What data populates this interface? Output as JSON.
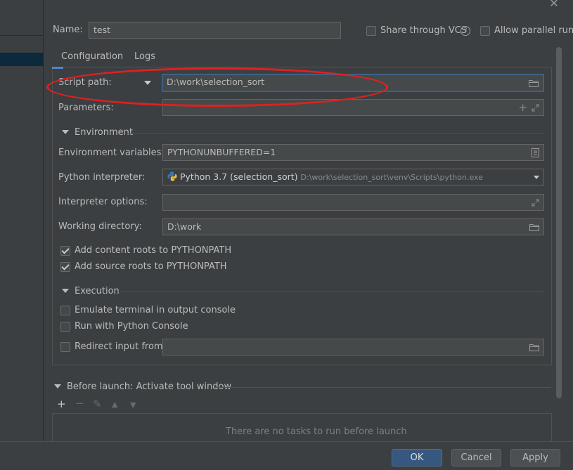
{
  "header": {
    "name_label": "Name:",
    "name_value": "test",
    "share_vcs_label": "Share through VCS",
    "allow_parallel_label": "Allow parallel run"
  },
  "tabs": [
    {
      "label": "Configuration"
    },
    {
      "label": "Logs"
    }
  ],
  "config": {
    "script_path_label": "Script path:",
    "script_path_value": "D:\\work\\selection_sort",
    "parameters_label": "Parameters:",
    "parameters_value": "",
    "environment_section": "Environment",
    "env_vars_label": "Environment variables:",
    "env_vars_value": "PYTHONUNBUFFERED=1",
    "interpreter_label": "Python interpreter:",
    "interpreter_name": "Python 3.7 (selection_sort)",
    "interpreter_path": "D:\\work\\selection_sort\\venv\\Scripts\\python.exe",
    "interpreter_options_label": "Interpreter options:",
    "interpreter_options_value": "",
    "working_dir_label": "Working directory:",
    "working_dir_value": "D:\\work",
    "add_content_roots_label": "Add content roots to PYTHONPATH",
    "add_source_roots_label": "Add source roots to PYTHONPATH",
    "execution_section": "Execution",
    "emulate_terminal_label": "Emulate terminal in output console",
    "run_python_console_label": "Run with Python Console",
    "redirect_input_label": "Redirect input from:",
    "redirect_input_value": ""
  },
  "checkbox_states": {
    "share_vcs": false,
    "allow_parallel": false,
    "add_content_roots": true,
    "add_source_roots": true,
    "emulate_terminal": false,
    "run_python_console": false,
    "redirect_input": false
  },
  "before_launch": {
    "title": "Before launch: Activate tool window",
    "empty_text": "There are no tasks to run before launch"
  },
  "buttons": {
    "ok": "OK",
    "cancel": "Cancel",
    "apply": "Apply"
  },
  "icons": {
    "close": "close-icon",
    "help": "help-icon",
    "folder": "folder-icon",
    "add": "plus-icon",
    "expand": "expand-icon",
    "document": "document-icon",
    "dropdown": "chevron-down-icon",
    "python": "python-icon"
  },
  "colors": {
    "background": "#3c3f41",
    "field_bg": "#45494a",
    "primary_button": "#365880",
    "annotation_ellipse": "#e02020",
    "focus_border": "#3d6185"
  }
}
